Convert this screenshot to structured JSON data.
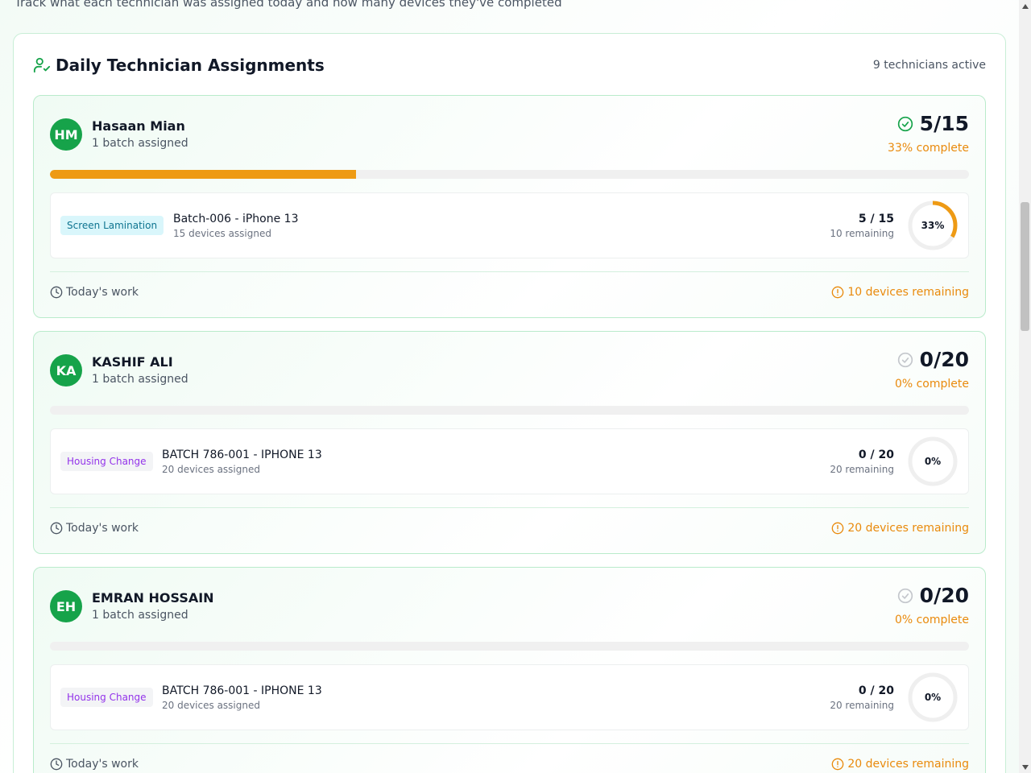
{
  "header": {
    "subtitle": "Track what each technician was assigned today and how many devices they've completed"
  },
  "panel": {
    "title": "Daily Technician Assignments",
    "active_count": "9 technicians active",
    "icon": "user-check-icon"
  },
  "colors": {
    "accent_green": "#16a34a",
    "progress_orange": "#ee9a14",
    "pct_orange": "#e98a0c"
  },
  "technicians": [
    {
      "initials": "HM",
      "name": "Hasaan Mian",
      "batches": "1 batch assigned",
      "score": "5/15",
      "pct_complete": "33% complete",
      "progress": 0.3333,
      "status_icon": "check-circle-icon",
      "batch": {
        "tag": "Screen Lamination",
        "name": "Batch-006 - iPhone 13",
        "devices": "15 devices assigned",
        "count": "5 / 15",
        "remaining": "10 remaining",
        "ring_label": "33%"
      },
      "footer_left": "Today's work",
      "footer_right": "10 devices remaining"
    },
    {
      "initials": "KA",
      "name": "KASHIF ALI",
      "batches": "1 batch assigned",
      "score": "0/20",
      "pct_complete": "0% complete",
      "progress": 0,
      "status_icon": "check-circle-icon",
      "batch": {
        "tag": "Housing Change",
        "name": "BATCH 786-001 - IPHONE 13",
        "devices": "20 devices assigned",
        "count": "0 / 20",
        "remaining": "20 remaining",
        "ring_label": "0%"
      },
      "footer_left": "Today's work",
      "footer_right": "20 devices remaining"
    },
    {
      "initials": "EH",
      "name": "EMRAN HOSSAIN",
      "batches": "1 batch assigned",
      "score": "0/20",
      "pct_complete": "0% complete",
      "progress": 0,
      "status_icon": "check-circle-icon",
      "batch": {
        "tag": "Housing Change",
        "name": "BATCH 786-001 - IPHONE 13",
        "devices": "20 devices assigned",
        "count": "0 / 20",
        "remaining": "20 remaining",
        "ring_label": "0%"
      },
      "footer_left": "Today's work",
      "footer_right": "20 devices remaining"
    }
  ]
}
